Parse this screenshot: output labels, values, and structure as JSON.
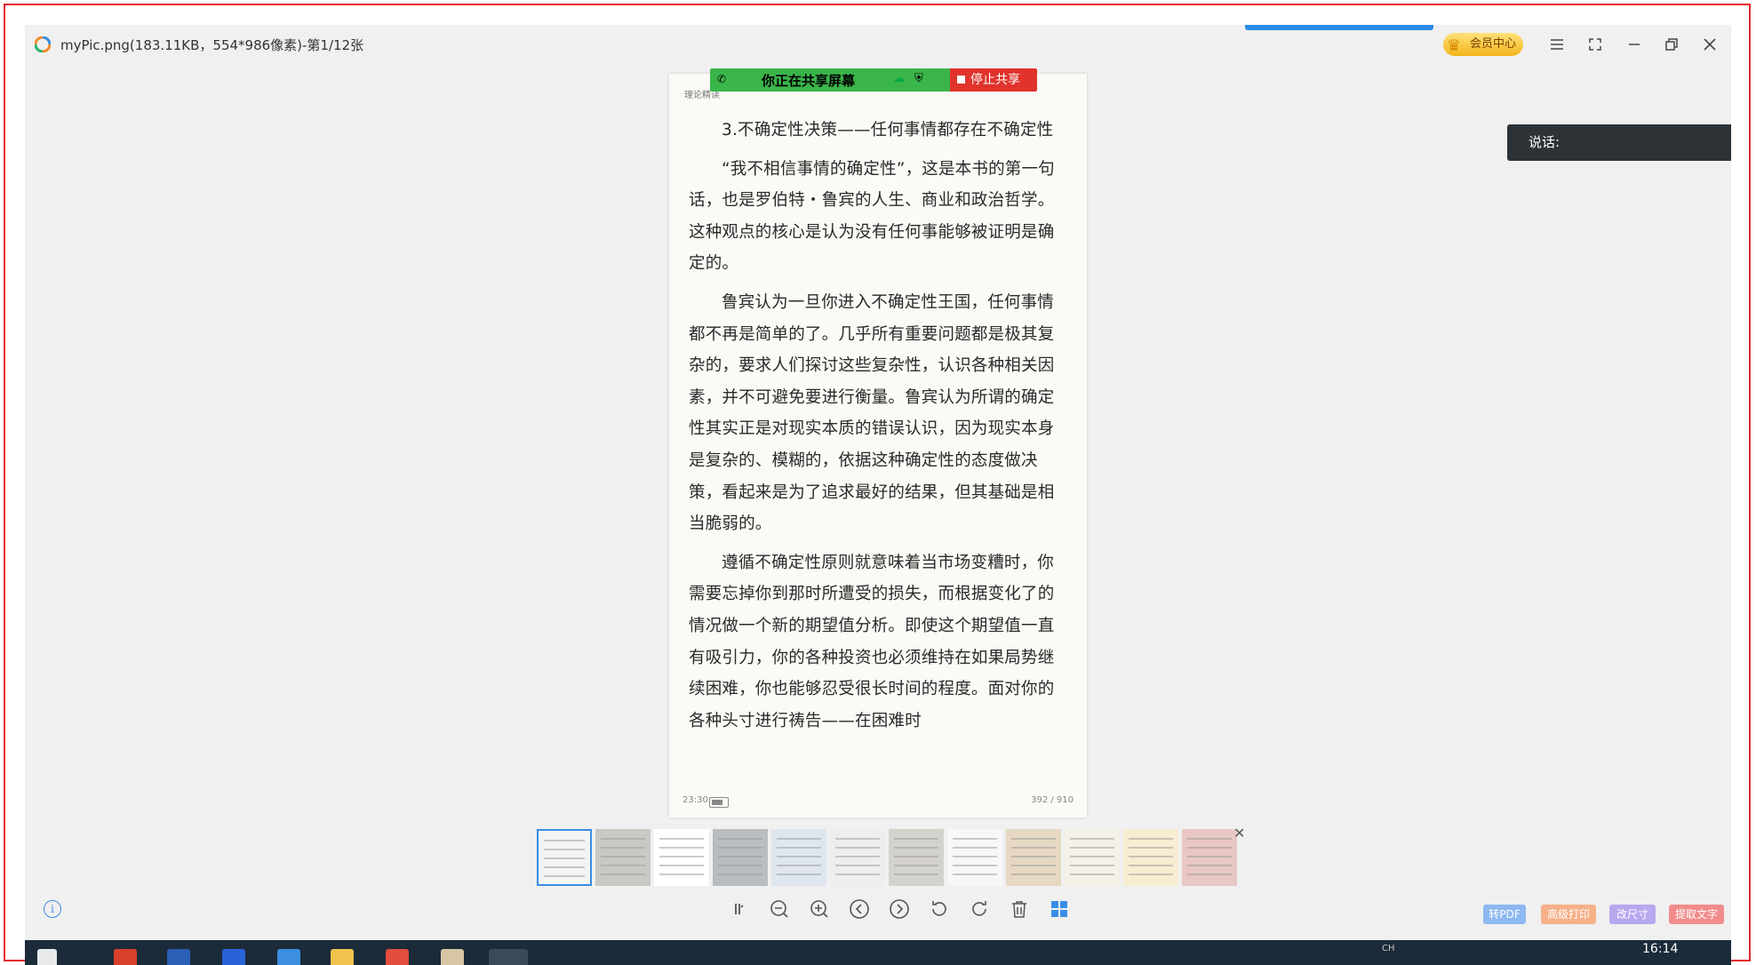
{
  "window": {
    "title": "myPic.png(183.11KB，554*986像素)-第1/12张",
    "vip_label": "会员中心"
  },
  "share_bar": {
    "status": "你正在共享屏幕",
    "stop_label": "停止共享"
  },
  "speak_box": {
    "label": "说话:"
  },
  "page": {
    "header_small": "理论精读",
    "heading": "3.不确定性决策——任何事情都存在不确定性",
    "paragraphs": [
      "“我不相信事情的确定性”，这是本书的第一句话，也是罗伯特・鲁宾的人生、商业和政治哲学。这种观点的核心是认为没有任何事能够被证明是确定的。",
      "鲁宾认为一旦你进入不确定性王国，任何事情都不再是简单的了。几乎所有重要问题都是极其复杂的，要求人们探讨这些复杂性，认识各种相关因素，并不可避免要进行衡量。鲁宾认为所谓的确定性其实正是对现实本质的错误认识，因为现实本身是复杂的、模糊的，依据这种确定性的态度做决策，看起来是为了追求最好的结果，但其基础是相当脆弱的。",
      "遵循不确定性原则就意味着当市场变糟时，你需要忘掉你到那时所遭受的损失，而根据变化了的情况做一个新的期望值分析。即使这个期望值一直有吸引力，你的各种投资也必须维持在如果局势继续困难，你也能够忍受很长时间的程度。面对你的各种头寸进行祷告——在困难时"
    ],
    "footer_time": "23:30",
    "footer_page": "392 / 910"
  },
  "thumbnails": [
    {
      "name": "thumb-1",
      "bg": "#f4f4f4"
    },
    {
      "name": "thumb-2",
      "bg": "#c9c9c4"
    },
    {
      "name": "thumb-3",
      "bg": "#ffffff"
    },
    {
      "name": "thumb-4",
      "bg": "#b9bdbf"
    },
    {
      "name": "thumb-5",
      "bg": "#dfe6ee"
    },
    {
      "name": "thumb-6",
      "bg": "#eeeeee"
    },
    {
      "name": "thumb-7",
      "bg": "#d4d2cc"
    },
    {
      "name": "thumb-8",
      "bg": "#f7f7f7"
    },
    {
      "name": "thumb-9",
      "bg": "#e6d8c2"
    },
    {
      "name": "thumb-10",
      "bg": "#f4f1e6"
    },
    {
      "name": "thumb-11",
      "bg": "#f6edd2"
    },
    {
      "name": "thumb-12",
      "bg": "#e8c7c4"
    }
  ],
  "toolbar": {
    "icons": [
      "slideshow-icon",
      "zoom-out-icon",
      "zoom-in-icon",
      "previous-icon",
      "next-icon",
      "rotate-left-icon",
      "rotate-right-icon",
      "delete-icon",
      "grid-view-icon"
    ]
  },
  "actions": {
    "to_pdf": "转PDF",
    "advanced_print": "高级打印",
    "resize": "改尺寸",
    "extract_text": "提取文字"
  },
  "taskbar": {
    "clock": "16:14",
    "tray_ime": "CH"
  },
  "colors": {
    "accent": "#3a8ee6",
    "share_green": "#3ab54a",
    "share_red": "#e0332b",
    "frame_red": "#e5262d"
  }
}
